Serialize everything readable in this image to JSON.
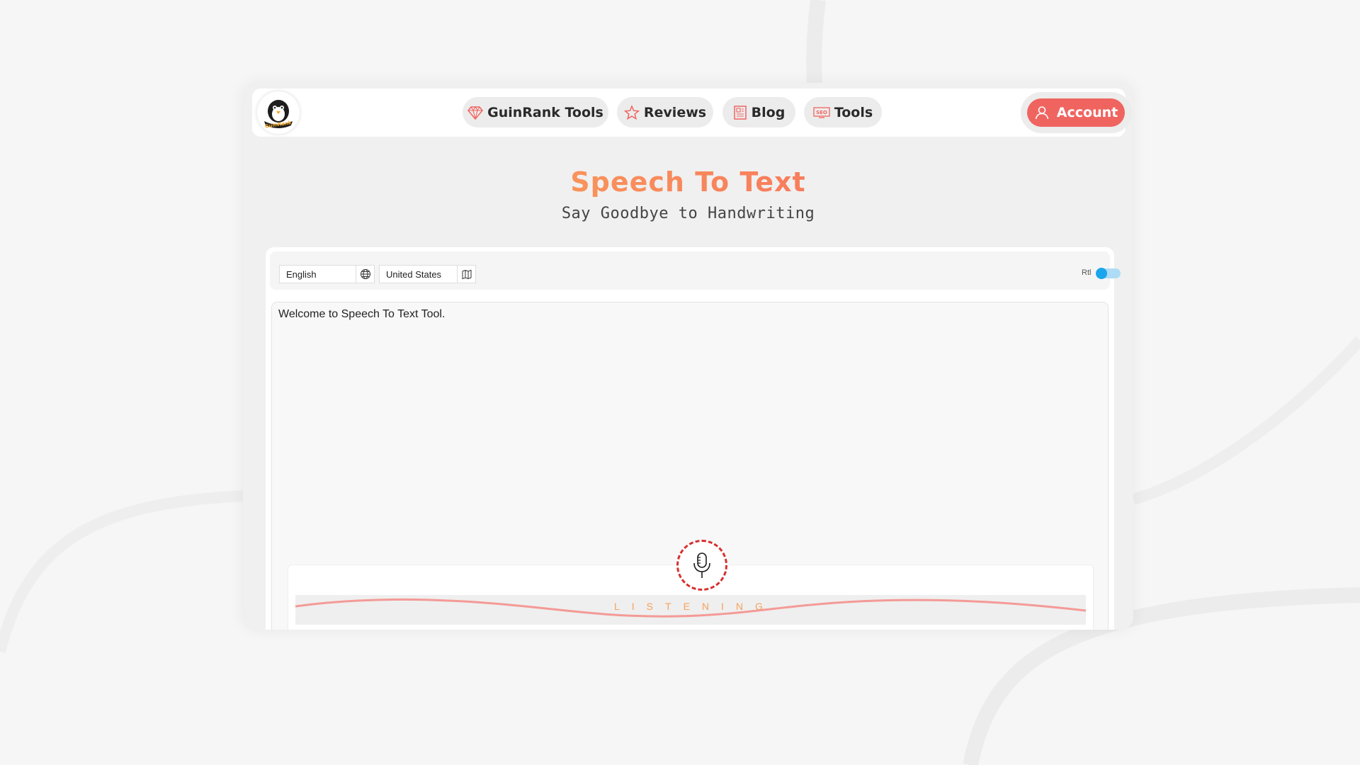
{
  "nav": {
    "items": [
      {
        "label": "GuinRank Tools",
        "icon": "diamond-icon"
      },
      {
        "label": "Reviews",
        "icon": "star-icon"
      },
      {
        "label": "Blog",
        "icon": "newspaper-icon"
      },
      {
        "label": "Tools",
        "icon": "seo-icon"
      }
    ],
    "account_label": "Account",
    "logo_text": "GuinRank"
  },
  "hero": {
    "title": "Speech To Text",
    "subtitle": "Say Goodbye to Handwriting"
  },
  "toolbar": {
    "language_value": "English",
    "country_value": "United States",
    "rtl_label": "Rtl",
    "rtl_enabled": false
  },
  "editor": {
    "text": "Welcome to Speech To Text Tool."
  },
  "mic": {
    "status_label": "LISTENING"
  },
  "colors": {
    "accent": "#f06460",
    "title_gradient_start": "#fbb45a",
    "title_gradient_end": "#f56a5e",
    "toggle": "#1ba5ec",
    "wave": "#f49a96",
    "mic_ring": "#d62f2f"
  }
}
